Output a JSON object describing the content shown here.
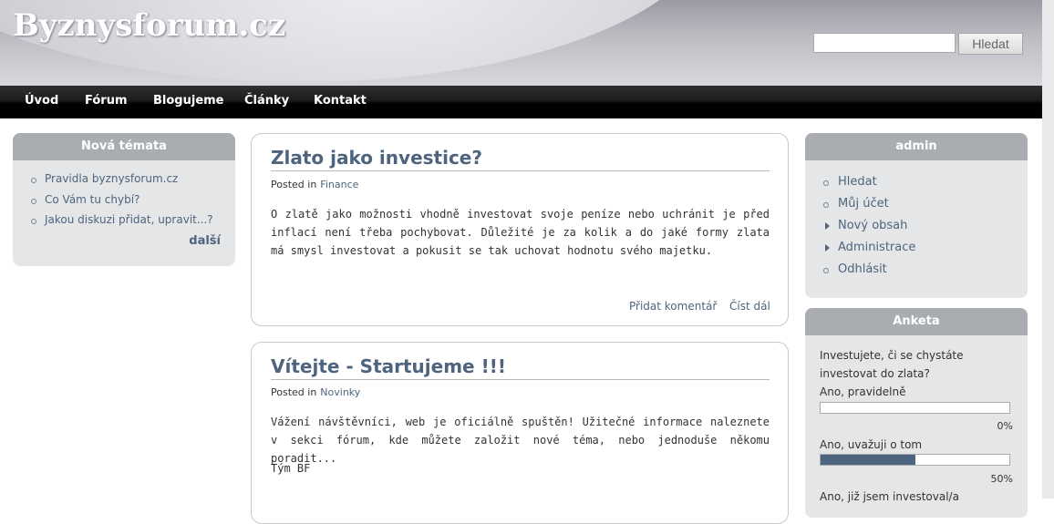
{
  "site": {
    "title": "Byznysforum.cz"
  },
  "search": {
    "value": "",
    "placeholder": "",
    "button_label": "Hledat"
  },
  "nav": {
    "items": [
      "Úvod",
      "Fórum",
      "Blogujeme",
      "Články",
      "Kontakt"
    ]
  },
  "left_block": {
    "title": "Nová témata",
    "items": [
      "Pravidla byznysforum.cz",
      "Co Vám tu chybí?",
      "Jakou diskuzi přidat, upravit...?"
    ],
    "more_label": "další"
  },
  "articles": [
    {
      "title": "Zlato jako investice?",
      "posted_in": "Posted in",
      "category": "Finance",
      "body": "O zlatě jako možnosti vhodně investovat svoje peníze nebo uchránit je před inflací není třeba pochybovat. Důležité je za kolik a do jaké formy zlata má smysl investovat a pokusit se tak uchovat hodnotu svého majetku.",
      "add_comment": "Přidat komentář",
      "read_more": "Číst dál"
    },
    {
      "title": "Vítejte - Startujeme !!!",
      "posted_in": "Posted in",
      "category": "Novinky",
      "body": "Vážení návštěvníci, web je oficiálně spuštěn! Užitečné informace naleznete v sekci fórum, kde můžete založit nové téma, nebo jednoduše někomu poradit...",
      "signature": "Tým BF"
    }
  ],
  "user_block": {
    "title": "admin",
    "items": [
      {
        "label": "Hledat",
        "bullet": "circle"
      },
      {
        "label": "Můj účet",
        "bullet": "circle"
      },
      {
        "label": "Nový obsah",
        "bullet": "triangle"
      },
      {
        "label": "Administrace",
        "bullet": "triangle"
      },
      {
        "label": "Odhlásit",
        "bullet": "circle"
      }
    ]
  },
  "poll": {
    "title": "Anketa",
    "question": "Investujete, či se chystáte investovat do zlata?",
    "options": [
      {
        "label": "Ano, pravidelně",
        "percent": 0,
        "percent_label": "0%"
      },
      {
        "label": "Ano, uvažuji o tom",
        "percent": 50,
        "percent_label": "50%"
      },
      {
        "label": "Ano, již jsem investoval/a"
      }
    ]
  },
  "colors": {
    "accent": "#4e647e",
    "block_bg": "#e5e6e8",
    "block_header": "#a9adb1",
    "nav_bg": "#000000"
  }
}
